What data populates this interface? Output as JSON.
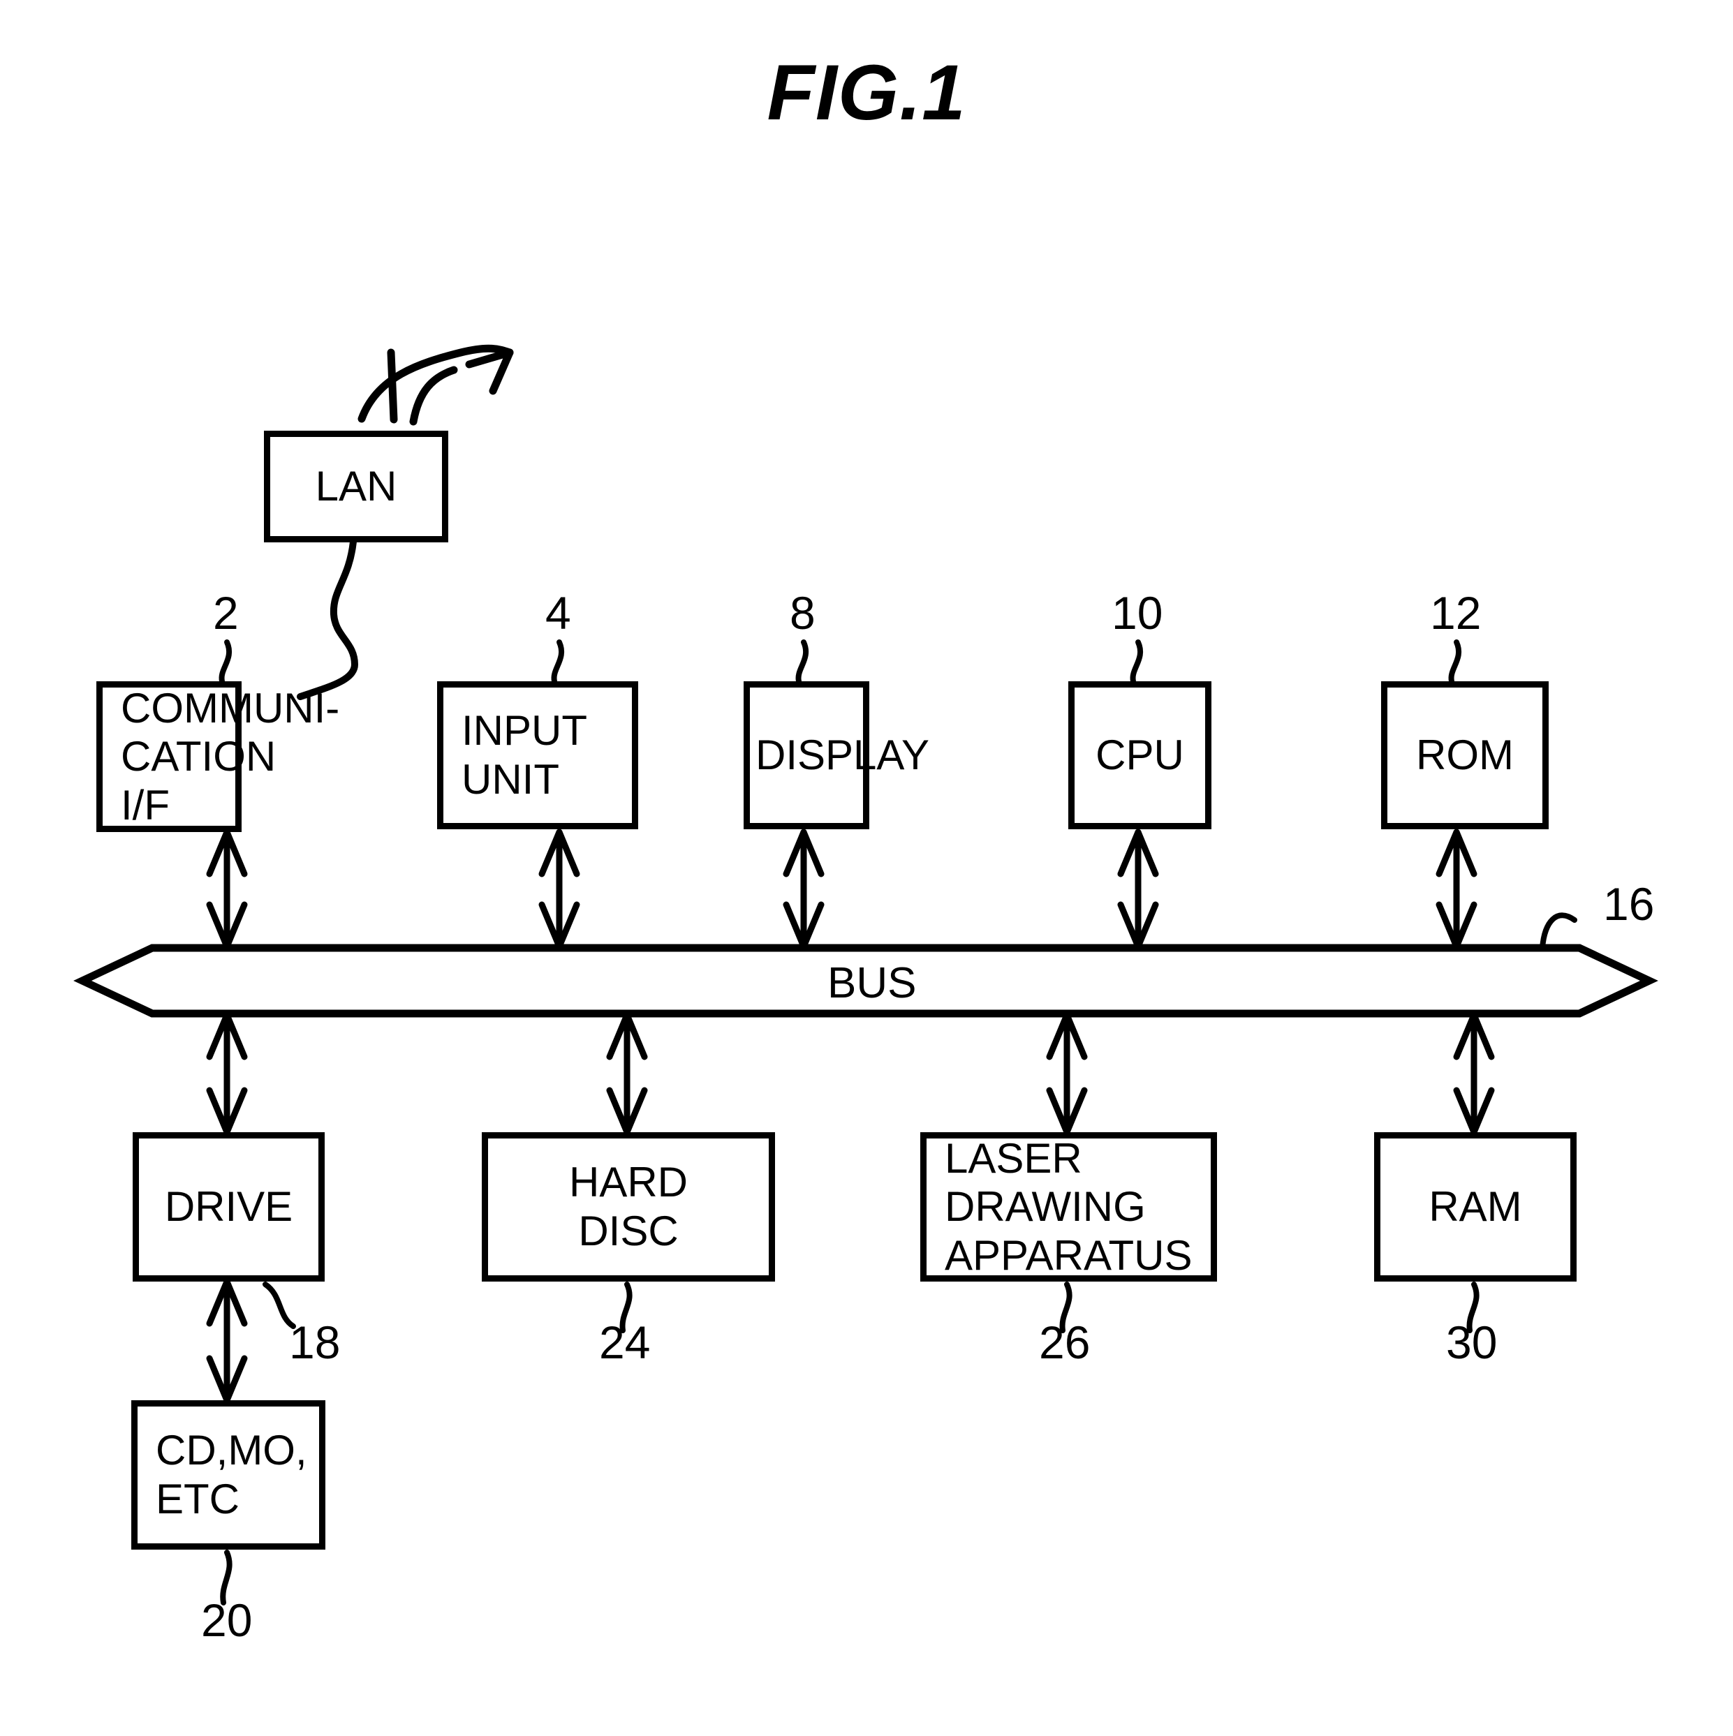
{
  "figure": {
    "title": "FIG.1",
    "type": "patent-block-diagram"
  },
  "nodes": {
    "lan": {
      "label": "LAN",
      "ref": ""
    },
    "communication_if": {
      "label": "COMMUNI-\nCATION\nI/F",
      "ref": "2"
    },
    "input_unit": {
      "label": "INPUT\nUNIT",
      "ref": "4"
    },
    "display": {
      "label": "DISPLAY",
      "ref": "8"
    },
    "cpu": {
      "label": "CPU",
      "ref": "10"
    },
    "rom": {
      "label": "ROM",
      "ref": "12"
    },
    "bus": {
      "label": "BUS",
      "ref": "16"
    },
    "drive": {
      "label": "DRIVE",
      "ref": "18"
    },
    "hard_disc": {
      "label": "HARD\nDISC",
      "ref": "24"
    },
    "laser_drawing_apparatus": {
      "label": "LASER\nDRAWING\nAPPARATUS",
      "ref": "26"
    },
    "ram": {
      "label": "RAM",
      "ref": "30"
    },
    "cd_mo_etc": {
      "label": "CD,MO,\nETC",
      "ref": "20"
    }
  },
  "connections": [
    {
      "from": "lan",
      "to": "external",
      "style": "curved-arrow"
    },
    {
      "from": "lan",
      "to": "communication_if",
      "style": "wavy-line"
    },
    {
      "from": "communication_if",
      "to": "bus",
      "style": "double-arrow"
    },
    {
      "from": "input_unit",
      "to": "bus",
      "style": "double-arrow"
    },
    {
      "from": "display",
      "to": "bus",
      "style": "double-arrow"
    },
    {
      "from": "cpu",
      "to": "bus",
      "style": "double-arrow"
    },
    {
      "from": "rom",
      "to": "bus",
      "style": "double-arrow"
    },
    {
      "from": "bus",
      "to": "drive",
      "style": "double-arrow"
    },
    {
      "from": "bus",
      "to": "hard_disc",
      "style": "double-arrow"
    },
    {
      "from": "bus",
      "to": "laser_drawing_apparatus",
      "style": "double-arrow"
    },
    {
      "from": "bus",
      "to": "ram",
      "style": "double-arrow"
    },
    {
      "from": "drive",
      "to": "cd_mo_etc",
      "style": "double-arrow"
    }
  ],
  "colors": {
    "ink": "#000000",
    "paper": "#ffffff"
  }
}
